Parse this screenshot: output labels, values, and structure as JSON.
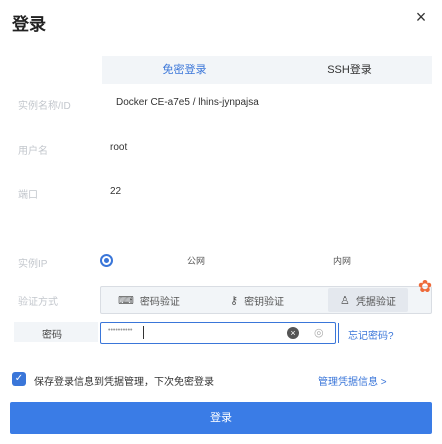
{
  "dialog": {
    "title": "登录",
    "close_glyph": "×"
  },
  "tabs": [
    {
      "label": "免密登录",
      "active": true
    },
    {
      "label": "SSH登录",
      "active": false
    }
  ],
  "fields": {
    "instance": {
      "label": "实例名称/ID",
      "value": "Docker CE-a7e5 / lhins-jynpajsa"
    },
    "username": {
      "label": "用户名",
      "value": "root"
    },
    "port": {
      "label": "端口",
      "value": "22"
    },
    "ip": {
      "label": "实例IP",
      "options": [
        "公网",
        "内网"
      ]
    },
    "auth": {
      "label": "验证方式",
      "options": [
        "密码验证",
        "密钥验证",
        "凭据验证"
      ],
      "selected": "凭据验证"
    }
  },
  "password": {
    "label": "密码",
    "mask": "••••••••••",
    "clear_glyph": "×",
    "eye_glyph": "◎",
    "forgot_link": "忘记密码?"
  },
  "agreement": {
    "check_glyph": "✓",
    "text": "保存登录信息到凭据管理，下次免密登录",
    "manage_link": "管理凭据信息 >"
  },
  "login_button": "登录",
  "colors": {
    "accent": "#3a76d9",
    "warning": "#ee6a3a"
  },
  "icons": {
    "password_auth": "keyboard-icon",
    "key_auth": "key-icon",
    "credential_auth": "user-icon",
    "warning": "gear-warning-icon"
  }
}
